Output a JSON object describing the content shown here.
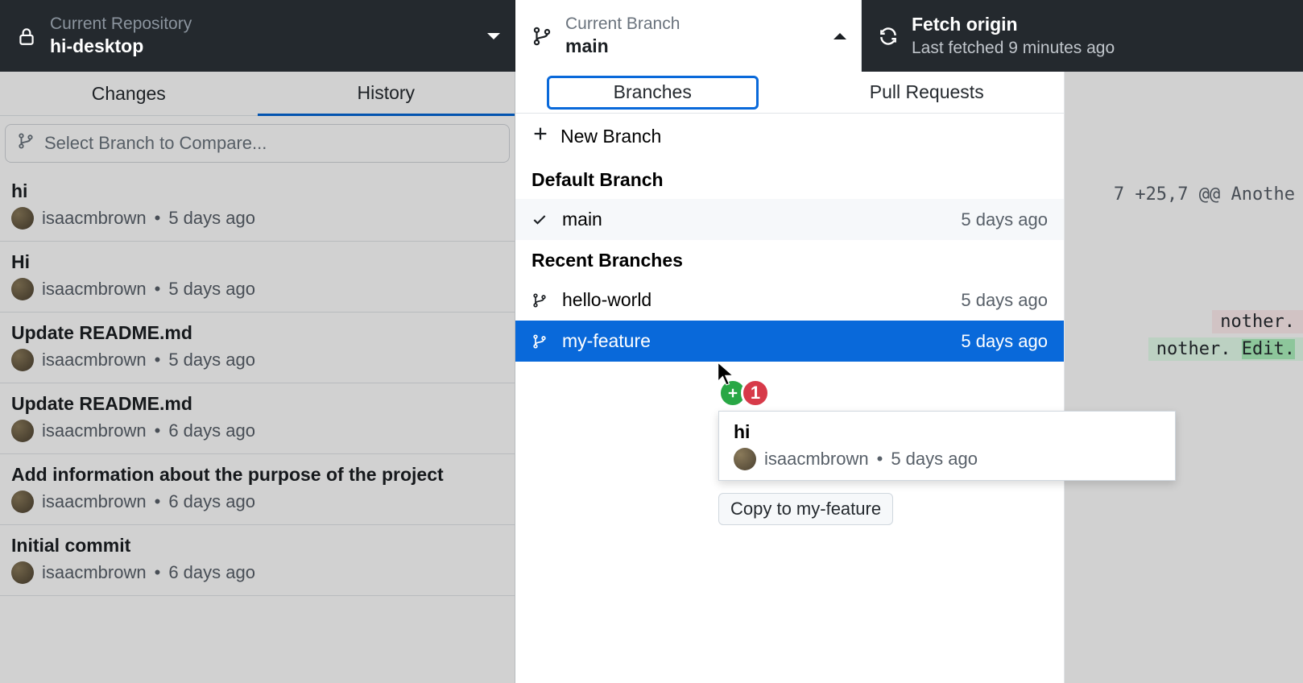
{
  "header": {
    "repo_label": "Current Repository",
    "repo_value": "hi-desktop",
    "branch_label": "Current Branch",
    "branch_value": "main",
    "fetch_label": "Fetch origin",
    "fetch_value": "Last fetched 9 minutes ago"
  },
  "left": {
    "tabs": {
      "changes": "Changes",
      "history": "History"
    },
    "compare_placeholder": "Select Branch to Compare...",
    "commits": [
      {
        "title": "hi",
        "author": "isaacmbrown",
        "time": "5 days ago"
      },
      {
        "title": "Hi",
        "author": "isaacmbrown",
        "time": "5 days ago"
      },
      {
        "title": "Update README.md",
        "author": "isaacmbrown",
        "time": "5 days ago"
      },
      {
        "title": "Update README.md",
        "author": "isaacmbrown",
        "time": "6 days ago"
      },
      {
        "title": "Add information about the purpose of the project",
        "author": "isaacmbrown",
        "time": "6 days ago"
      },
      {
        "title": "Initial commit",
        "author": "isaacmbrown",
        "time": "6 days ago"
      }
    ]
  },
  "dropdown": {
    "tabs": {
      "branches": "Branches",
      "pull_requests": "Pull Requests"
    },
    "new_branch": "New Branch",
    "default_heading": "Default Branch",
    "recent_heading": "Recent Branches",
    "default_branch": {
      "name": "main",
      "time": "5 days ago"
    },
    "recent": [
      {
        "name": "hello-world",
        "time": "5 days ago"
      },
      {
        "name": "my-feature",
        "time": "5 days ago"
      }
    ]
  },
  "drag": {
    "badge_count": "1",
    "title": "hi",
    "author": "isaacmbrown",
    "time": "5 days ago",
    "tooltip": "Copy to my-feature"
  },
  "diff": {
    "hunk": "7 +25,7 @@ Anothe",
    "del": "nother.",
    "add_pre": "nother. ",
    "add_hl": "Edit."
  }
}
